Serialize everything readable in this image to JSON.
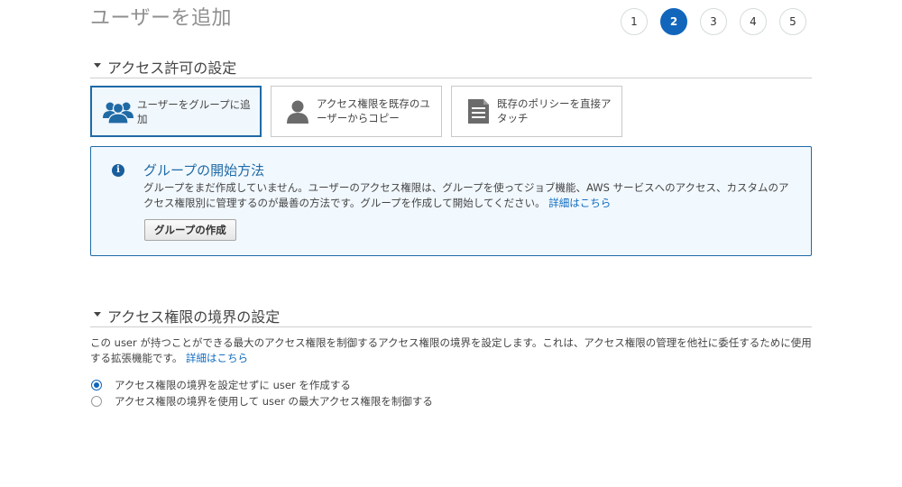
{
  "page": {
    "title": "ユーザーを追加"
  },
  "steps": [
    {
      "label": "1",
      "active": false
    },
    {
      "label": "2",
      "active": true
    },
    {
      "label": "3",
      "active": false
    },
    {
      "label": "4",
      "active": false
    },
    {
      "label": "5",
      "active": false
    }
  ],
  "permissions": {
    "title": "アクセス許可の設定",
    "options": [
      {
        "label": "ユーザーをグループに追加",
        "icon": "users-group-icon",
        "selected": true
      },
      {
        "label": "アクセス権限を既存のユーザーからコピー",
        "icon": "user-icon",
        "selected": false
      },
      {
        "label": "既存のポリシーを直接アタッチ",
        "icon": "document-icon",
        "selected": false
      }
    ],
    "info": {
      "icon": "info-icon",
      "icon_glyph": "i",
      "title": "グループの開始方法",
      "text": "グループをまだ作成していません。ユーザーのアクセス権限は、グループを使ってジョブ機能、AWS サービスへのアクセス、カスタムのアクセス権限別に管理するのが最善の方法です。グループを作成して開始してください。",
      "link": "詳細はこちら",
      "button": "グループの作成"
    }
  },
  "boundary": {
    "title": "アクセス権限の境界の設定",
    "description": "この user が持つことができる最大のアクセス権限を制御するアクセス権限の境界を設定します。これは、アクセス権限の管理を他社に委任するために使用する拡張機能です。",
    "link": "詳細はこちら",
    "radios": [
      {
        "label": "アクセス権限の境界を設定せずに user を作成する",
        "checked": true
      },
      {
        "label": "アクセス権限の境界を使用して user の最大アクセス権限を制御する",
        "checked": false
      }
    ]
  },
  "colors": {
    "accent": "#1166bb",
    "info_border": "#1f6aa5",
    "info_bg": "#f1f8fe",
    "link": "#0f6bbf"
  }
}
